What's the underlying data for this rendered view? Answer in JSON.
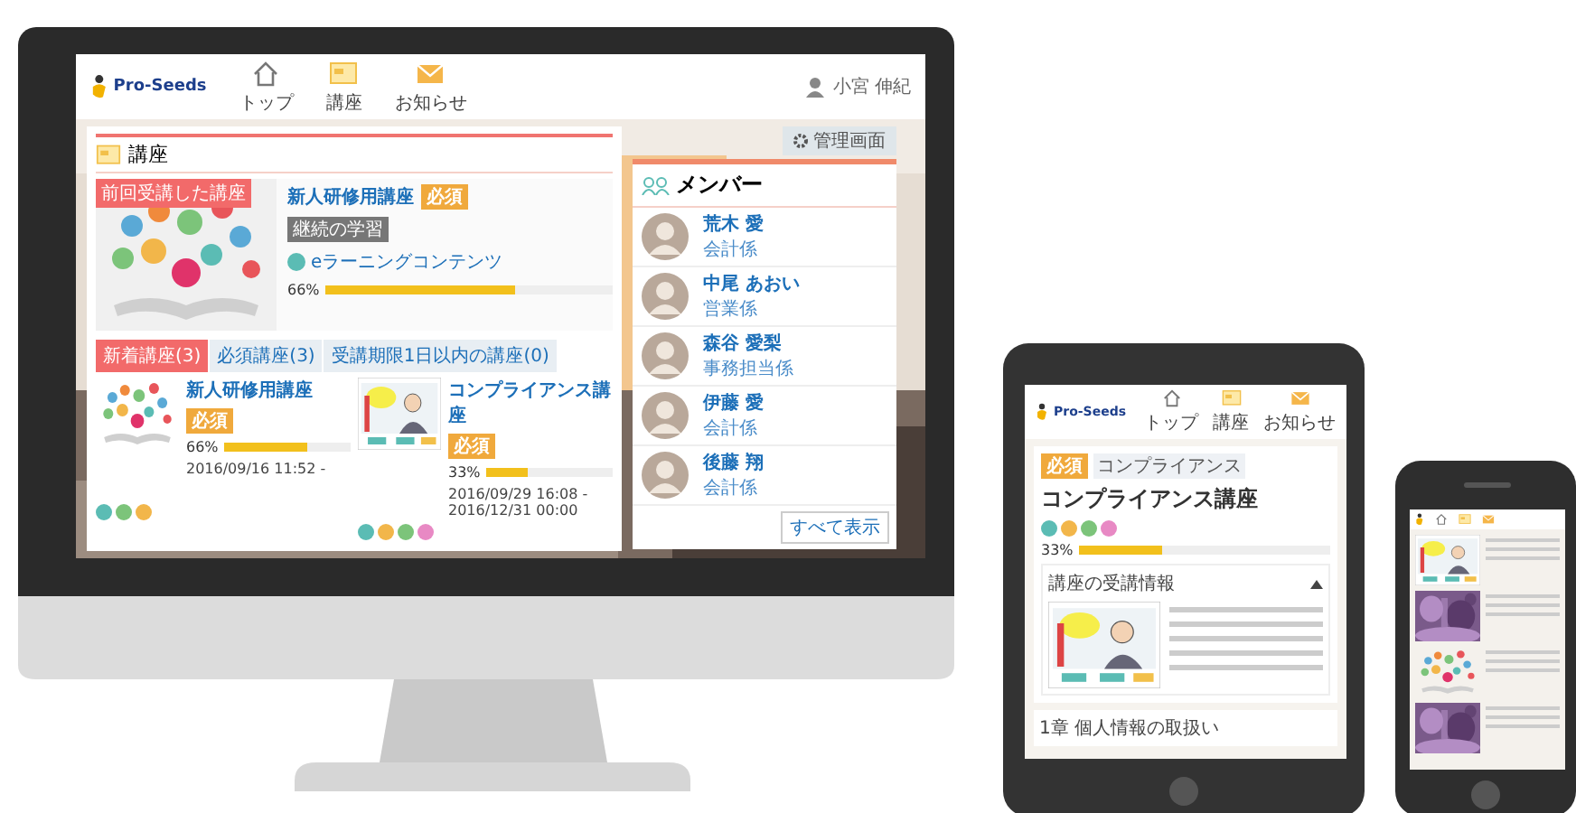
{
  "monitor": {
    "header": {
      "logo": "Pro-Seeds",
      "nav": [
        {
          "label": "トップ"
        },
        {
          "label": "講座"
        },
        {
          "label": "お知らせ"
        }
      ],
      "user": "小宮 伸紀"
    },
    "admin_button": "管理画面",
    "courses": {
      "title": "講座",
      "featured": {
        "badge": "前回受講した講座",
        "title": "新人研修用講座",
        "required": "必須",
        "tag": "継続の学習",
        "content": "eラーニングコンテンツ",
        "progress": "66%",
        "level": 0.66
      },
      "tabs": [
        {
          "label": "新着講座(3)",
          "selected": true
        },
        {
          "label": "必須講座(3)",
          "selected": false
        },
        {
          "label": "受講期限1日以内の講座(0)",
          "selected": false
        }
      ],
      "cards": [
        {
          "title": "新人研修用講座",
          "required": "必須",
          "progress": "66%",
          "level": 0.66,
          "period": "2016/09/16 11:52 -",
          "kind": "illustration",
          "icons": [
            {
              "color": "#5bbcb4"
            },
            {
              "color": "#7cc47a"
            },
            {
              "color": "#f2b64a"
            }
          ]
        },
        {
          "title": "コンプライアンス講座",
          "required": "必須",
          "progress": "33%",
          "level": 0.33,
          "period": "2016/09/29 16:08 - 2016/12/31 00:00",
          "kind": "comic",
          "icons": [
            {
              "color": "#5bbcb4"
            },
            {
              "color": "#f2b64a"
            },
            {
              "color": "#7cc47a"
            },
            {
              "color": "#e889c4"
            }
          ]
        }
      ]
    },
    "members": {
      "title": "メンバー",
      "list": [
        {
          "name": "荒木 愛",
          "role": "会計係"
        },
        {
          "name": "中尾 あおい",
          "role": "営業係"
        },
        {
          "name": "森谷 愛梨",
          "role": "事務担当係"
        },
        {
          "name": "伊藤 愛",
          "role": "会計係"
        },
        {
          "name": "後藤 翔",
          "role": "会計係"
        }
      ],
      "more_button": "すべて表示"
    }
  },
  "tablet": {
    "logo": "Pro-Seeds",
    "nav": [
      {
        "label": "トップ"
      },
      {
        "label": "講座"
      },
      {
        "label": "お知らせ"
      }
    ],
    "required": "必須",
    "tag": "コンプライアンス",
    "title": "コンプライアンス講座",
    "icons": [
      {
        "color": "#5bbcb4"
      },
      {
        "color": "#f2b64a"
      },
      {
        "color": "#7cc47a"
      },
      {
        "color": "#e889c4"
      }
    ],
    "progress": "33%",
    "level": 0.33,
    "section": "講座の受講情報",
    "chapter": "1章 個人情報の取扱い"
  },
  "phone": {
    "items": [
      {
        "kind": "comic"
      },
      {
        "kind": "picture"
      },
      {
        "kind": "illustration"
      },
      {
        "kind": "picture"
      }
    ]
  }
}
